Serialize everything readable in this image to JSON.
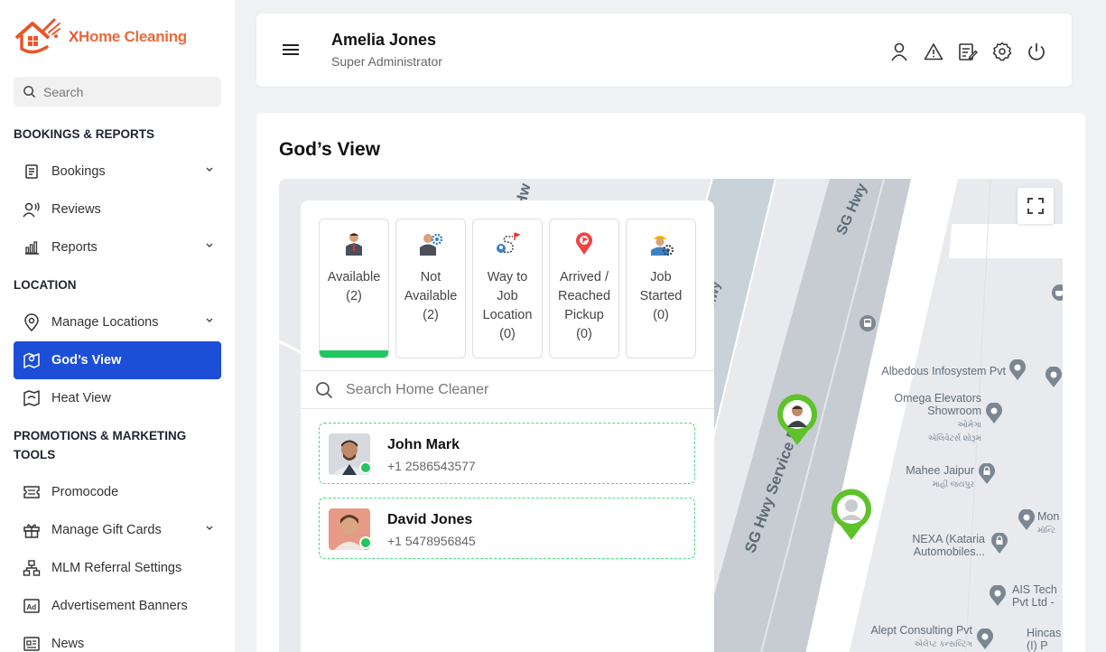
{
  "brand": {
    "name_x": "X",
    "name_rest": "Home Cleaning"
  },
  "sidebar": {
    "search_placeholder": "Search",
    "sections": {
      "bookings": "BOOKINGS & REPORTS",
      "location": "LOCATION",
      "promotions": "PROMOTIONS & MARKETING TOOLS"
    },
    "items": [
      {
        "label": "Bookings",
        "icon": "document-icon"
      },
      {
        "label": "Reviews",
        "icon": "reviews-icon"
      },
      {
        "label": "Reports",
        "icon": "bar-chart-icon"
      },
      {
        "label": "Manage Locations",
        "icon": "location-pin-icon"
      },
      {
        "label": "God’s View",
        "icon": "map-icon"
      },
      {
        "label": "Heat View",
        "icon": "heat-map-icon"
      },
      {
        "label": "Promocode",
        "icon": "ticket-icon"
      },
      {
        "label": "Manage Gift Cards",
        "icon": "gift-icon"
      },
      {
        "label": "MLM Referral Settings",
        "icon": "hierarchy-icon"
      },
      {
        "label": "Advertisement Banners",
        "icon": "ad-icon"
      },
      {
        "label": "News",
        "icon": "news-icon"
      }
    ]
  },
  "header": {
    "user_name": "Amelia Jones",
    "user_role": "Super Administrator"
  },
  "main": {
    "title": "God’s View",
    "statuses": [
      {
        "line1": "Available",
        "line2": "(2)",
        "line3": "",
        "line4": ""
      },
      {
        "line1": "Not",
        "line2": "Available",
        "line3": "(2)",
        "line4": ""
      },
      {
        "line1": "Way to",
        "line2": "Job",
        "line3": "Location",
        "line4": "(0)"
      },
      {
        "line1": "Arrived /",
        "line2": "Reached",
        "line3": "Pickup",
        "line4": "(0)"
      },
      {
        "line1": "Job",
        "line2": "Started",
        "line3": "(0)",
        "line4": ""
      }
    ],
    "search_placeholder": "Search Home Cleaner",
    "cleaners": [
      {
        "name": "John Mark",
        "phone": "+1 2586543577"
      },
      {
        "name": "David Jones",
        "phone": "+1 5478956845"
      }
    ]
  },
  "map": {
    "roads": [
      "SG Hwy",
      "SG Hwy Service Rd",
      "Hwy",
      "Hw"
    ],
    "places": [
      {
        "name": "Albedous Infosystem Pvt",
        "sub": ""
      },
      {
        "name": "Omega Elevators",
        "name2": "Showroom",
        "sub": "ઓમેગા",
        "sub2": "એલિવેટર્સ શોરૂમ"
      },
      {
        "name": "Mahee Jaipur",
        "sub": "માહી જયપુર"
      },
      {
        "name": "NEXA (Kataria",
        "name2": "Automobiles..."
      },
      {
        "name": "AIS Tech",
        "name2": "Pvt Ltd -"
      },
      {
        "name": "Mon",
        "sub": "મૉન્ટિ"
      },
      {
        "name": "Alept Consulting Pvt",
        "sub": "એલેપ્ટ કન્સલ્ટિંગ"
      },
      {
        "name": "Hincas",
        "name2": "(I) P"
      }
    ]
  },
  "colors": {
    "accent": "#1d4ed8",
    "brand": "#e8562a",
    "available": "#22c55e",
    "pin": "#5ec22b"
  }
}
